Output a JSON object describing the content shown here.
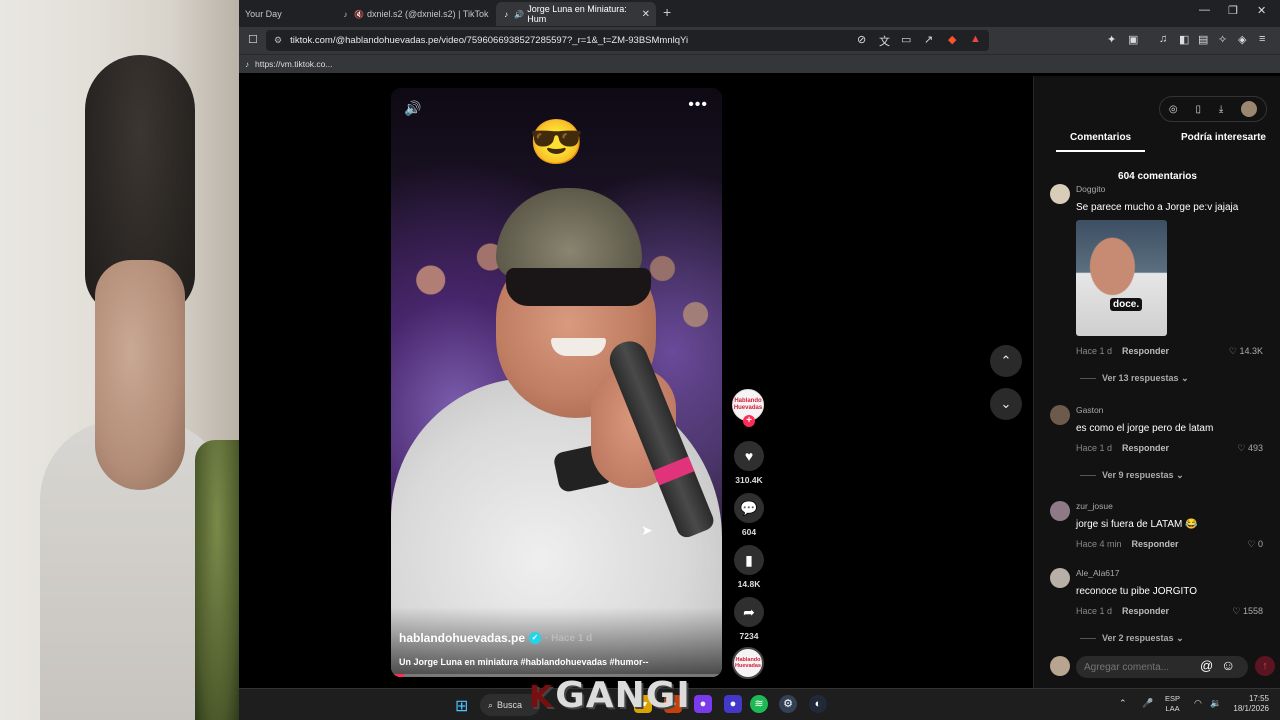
{
  "browser": {
    "tabs": [
      {
        "label": "Your Day",
        "icon": "none"
      },
      {
        "label": "dxniel.s2 (@dxniel.s2) | TikTok",
        "icon": "tiktok-icon"
      },
      {
        "label": "Jorge Luna en Miniatura: Hum",
        "icon": "tiktok-icon",
        "active": true
      }
    ],
    "url": "tiktok.com/@hablandohuevadas.pe/video/7596066938527285597?_r=1&_t=ZM-93BSMmnlqYi",
    "bookmark": "https://vm.tiktok.co..."
  },
  "video": {
    "emoji": "😎",
    "author": "hablandohuevadas.pe",
    "posted": "· Hace 1 d",
    "description": "Un Jorge Luna en miniatura #hablandohuevadas #humor--",
    "progress": 0.04,
    "creator_avatar_text": "Hablando Huevadas",
    "likes": "310.4K",
    "comments": "604",
    "saves": "14.8K",
    "shares": "7234"
  },
  "panel": {
    "tabs": [
      "Comentarios",
      "Podría interesarte"
    ],
    "count_label": "604 comentarios",
    "reply_label": "Responder",
    "input_placeholder": "Agregar comenta...",
    "comments": [
      {
        "user": "Doggito",
        "text": "Se parece mucho a Jorge pe:v jajaja",
        "time": "Hace 1 d",
        "likes": "14.3K",
        "more": "Ver 13 respuestas",
        "image_caption": "doce."
      },
      {
        "user": "Gaston",
        "text": "es como el jorge pero de latam",
        "time": "Hace 1 d",
        "likes": "493",
        "more": "Ver 9 respuestas"
      },
      {
        "user": "zur_josue",
        "text": "jorge si fuera de LATAM 😂",
        "time": "Hace 4 min",
        "likes": "0"
      },
      {
        "user": "Ale_Ala617",
        "text": "reconoce tu pibe JORGITO",
        "time": "Hace 1 d",
        "likes": "1558",
        "more": "Ver 2 respuestas"
      }
    ]
  },
  "taskbar": {
    "search_label": "Busca",
    "watermark": "GANGI",
    "lang": [
      "ESP",
      "LAA"
    ],
    "time": "17:55",
    "date": "18/1/2026"
  }
}
